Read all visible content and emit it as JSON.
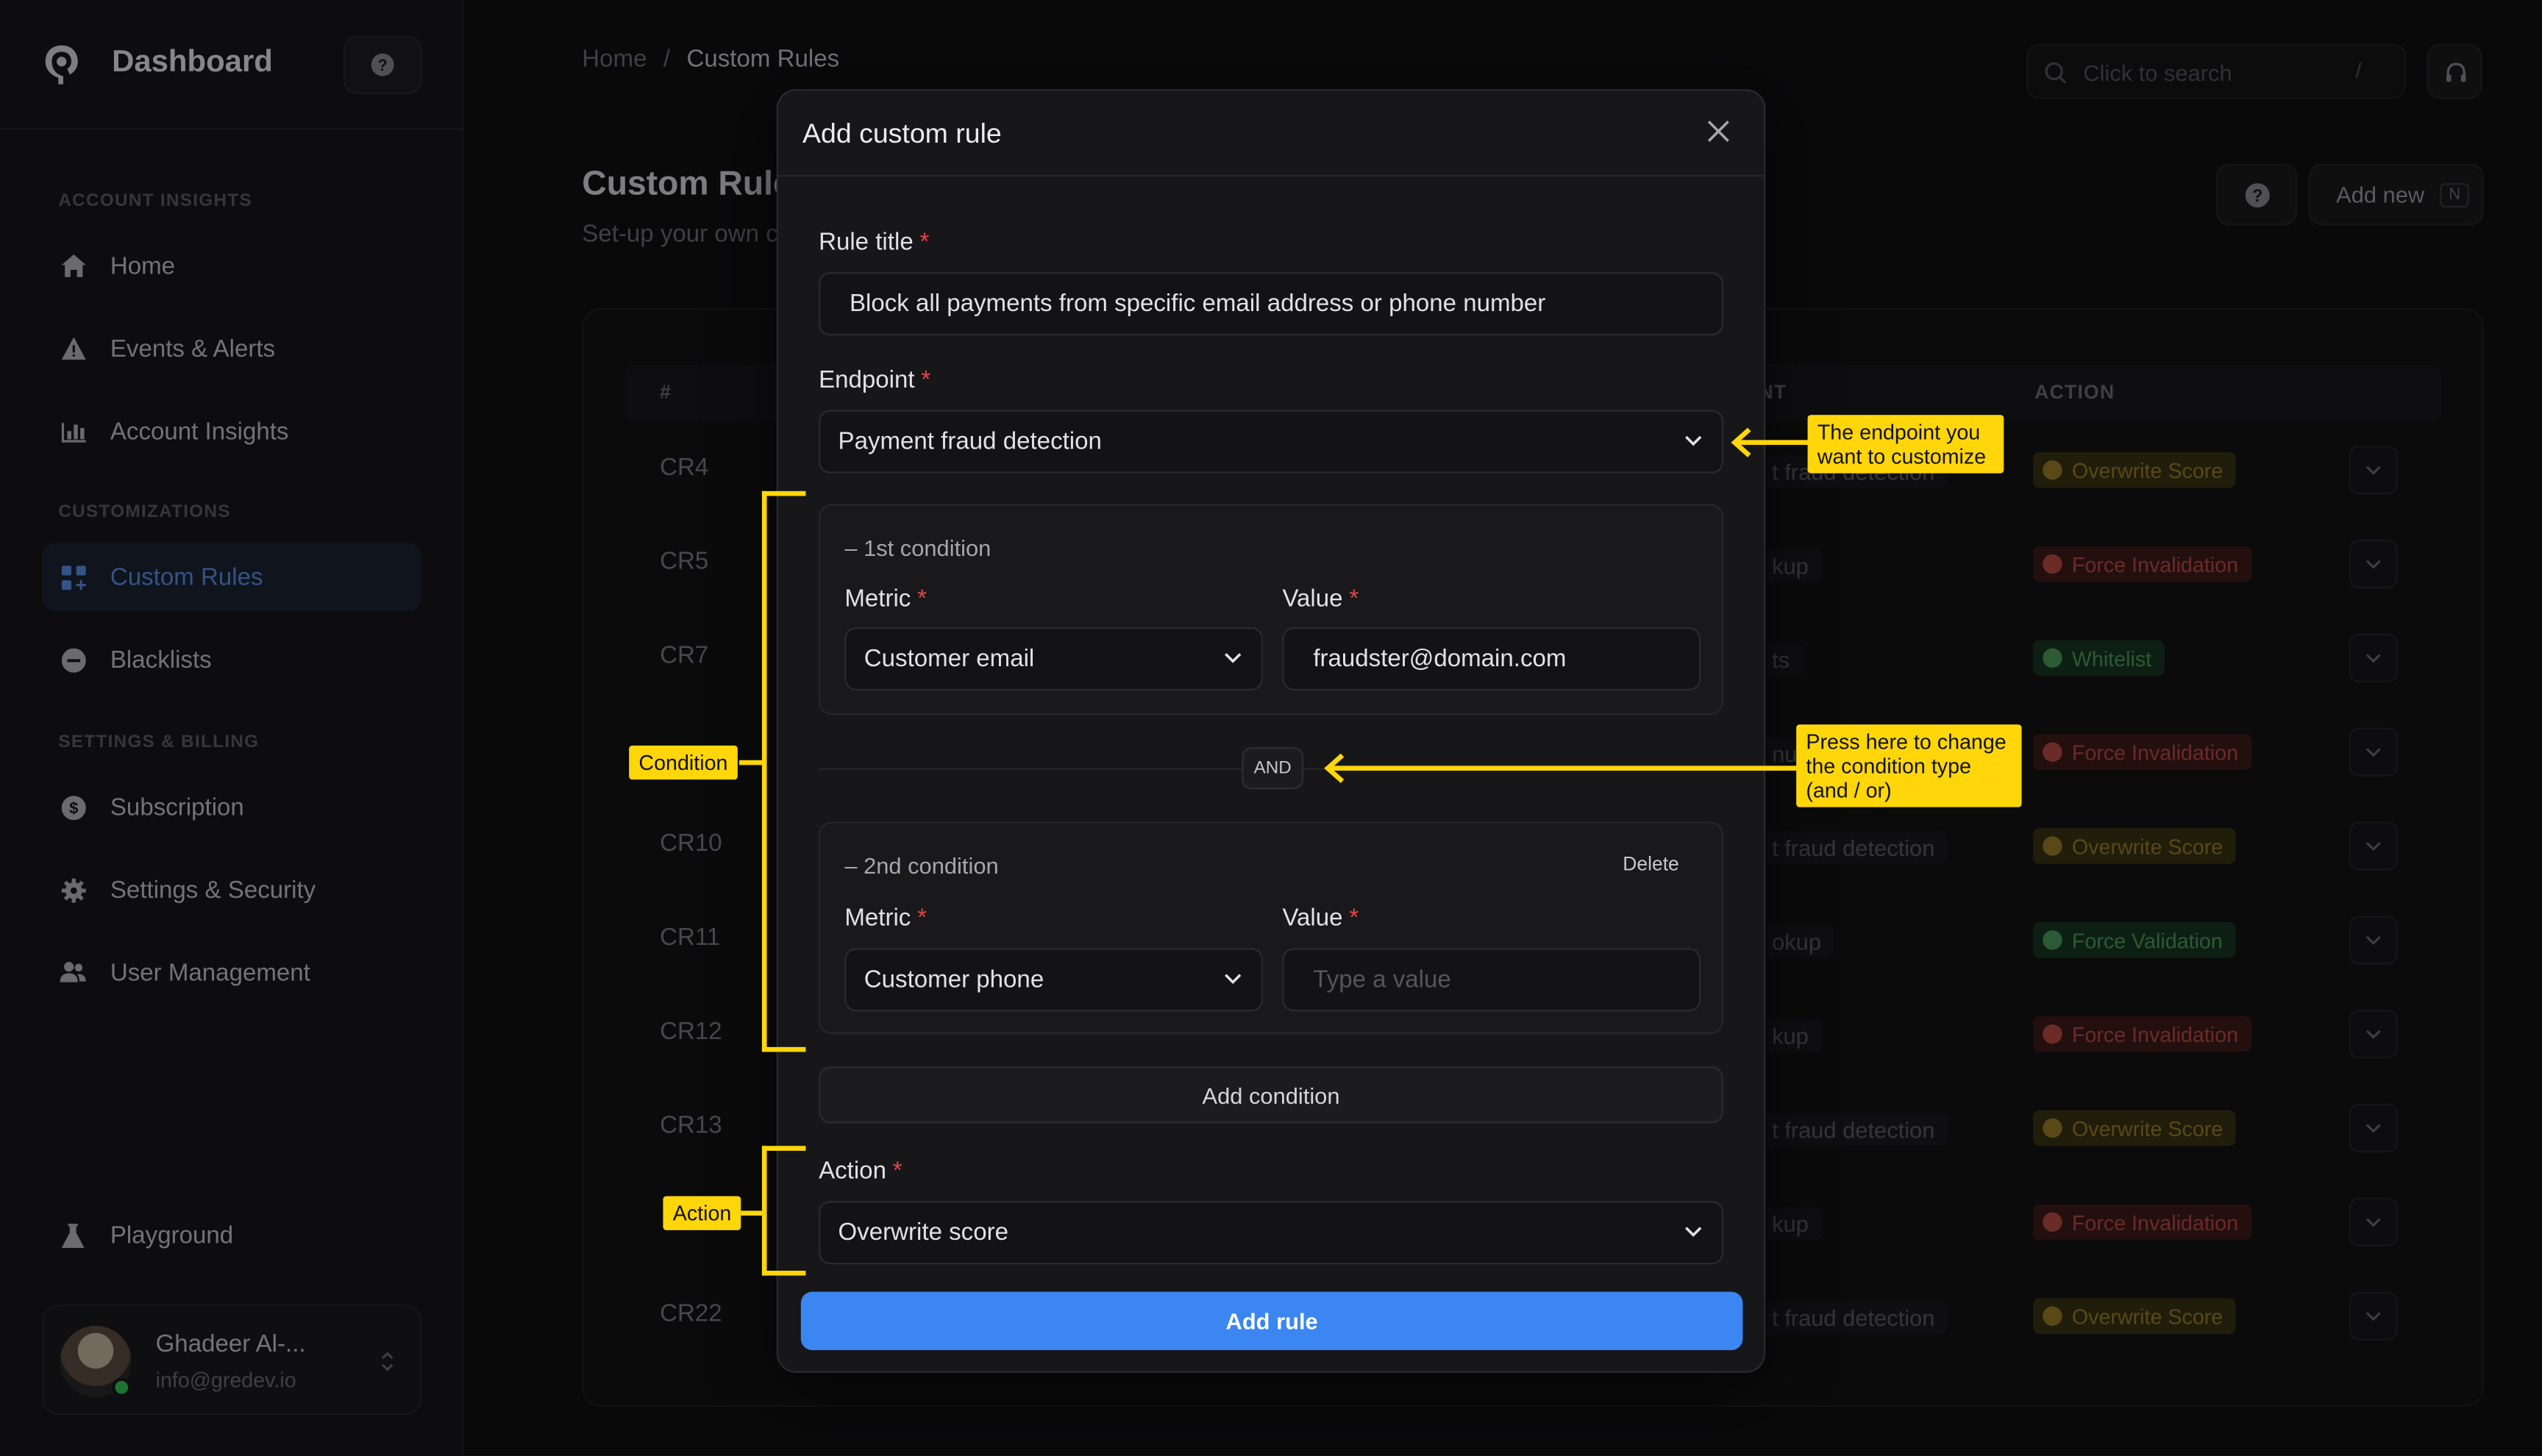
{
  "sidebar": {
    "brand": "Dashboard",
    "sections": [
      "ACCOUNT INSIGHTS",
      "CUSTOMIZATIONS",
      "SETTINGS & BILLING"
    ],
    "items": [
      {
        "label": "Home",
        "icon": "home-icon"
      },
      {
        "label": "Events & Alerts",
        "icon": "warning-icon"
      },
      {
        "label": "Account Insights",
        "icon": "bar-chart-icon"
      },
      {
        "label": "Custom Rules",
        "icon": "grid-plus-icon",
        "active": true
      },
      {
        "label": "Blacklists",
        "icon": "minus-circle-icon"
      },
      {
        "label": "Subscription",
        "icon": "dollar-circle-icon"
      },
      {
        "label": "Settings & Security",
        "icon": "gear-icon"
      },
      {
        "label": "User Management",
        "icon": "users-icon"
      },
      {
        "label": "Playground",
        "icon": "flask-icon"
      }
    ],
    "user": {
      "name": "Ghadeer Al-...",
      "email": "info@gredev.io"
    }
  },
  "header": {
    "breadcrumb_home": "Home",
    "breadcrumb_sep": "/",
    "breadcrumb_current": "Custom Rules",
    "search_placeholder": "Click to search",
    "search_shortcut": "/"
  },
  "main": {
    "title": "Custom Rules",
    "subtitle": "Set-up your own c",
    "add_new_label": "Add new",
    "add_new_shortcut": "N",
    "table": {
      "columns": {
        "id": "#",
        "endpoint": "NT",
        "action": "ACTION"
      },
      "rows": [
        {
          "id": "CR4",
          "endpoint": "t fraud detection",
          "action": "Overwrite Score",
          "kind": "overwrite"
        },
        {
          "id": "CR5",
          "endpoint": "kup",
          "action": "Force Invalidation",
          "kind": "invalid"
        },
        {
          "id": "CR7",
          "endpoint": "ts",
          "action": "Whitelist",
          "kind": "valid"
        },
        {
          "id": "",
          "endpoint": "num",
          "action": "Force Invalidation",
          "kind": "invalid"
        },
        {
          "id": "CR10",
          "endpoint": "t fraud detection",
          "action": "Overwrite Score",
          "kind": "overwrite"
        },
        {
          "id": "CR11",
          "endpoint": "okup",
          "action": "Force Validation",
          "kind": "valid"
        },
        {
          "id": "CR12",
          "endpoint": "kup",
          "action": "Force Invalidation",
          "kind": "invalid"
        },
        {
          "id": "CR13",
          "endpoint": "t fraud detection",
          "action": "Overwrite Score",
          "kind": "overwrite"
        },
        {
          "id": "",
          "endpoint": "kup",
          "action": "Force Invalidation",
          "kind": "invalid"
        },
        {
          "id": "CR22",
          "endpoint": "t fraud detection",
          "action": "Overwrite Score",
          "kind": "overwrite"
        }
      ]
    }
  },
  "modal": {
    "title": "Add custom rule",
    "rule_title_label": "Rule title",
    "rule_title_value": "Block all payments from specific email address or phone number",
    "endpoint_label": "Endpoint",
    "endpoint_value": "Payment fraud detection",
    "conditions": [
      {
        "title": "– 1st condition",
        "metric_label": "Metric",
        "metric_value": "Customer email",
        "value_label": "Value",
        "value": "fraudster@domain.com",
        "placeholder": ""
      },
      {
        "title": "– 2nd condition",
        "metric_label": "Metric",
        "metric_value": "Customer phone",
        "value_label": "Value",
        "value": "",
        "placeholder": "Type a value",
        "delete_label": "Delete"
      }
    ],
    "operator_label": "AND",
    "add_condition_label": "Add condition",
    "action_label": "Action",
    "action_value": "Overwrite score",
    "required_mark": "*",
    "submit_label": "Add rule"
  },
  "annotations": {
    "endpoint_note": "The endpoint you want to customize",
    "operator_note": "Press here to change the condition type (and / or)",
    "condition_tag": "Condition",
    "action_tag": "Action"
  },
  "colors": {
    "accent": "#3b86f0",
    "annotation": "#ffd60a",
    "required": "#e0464a"
  }
}
